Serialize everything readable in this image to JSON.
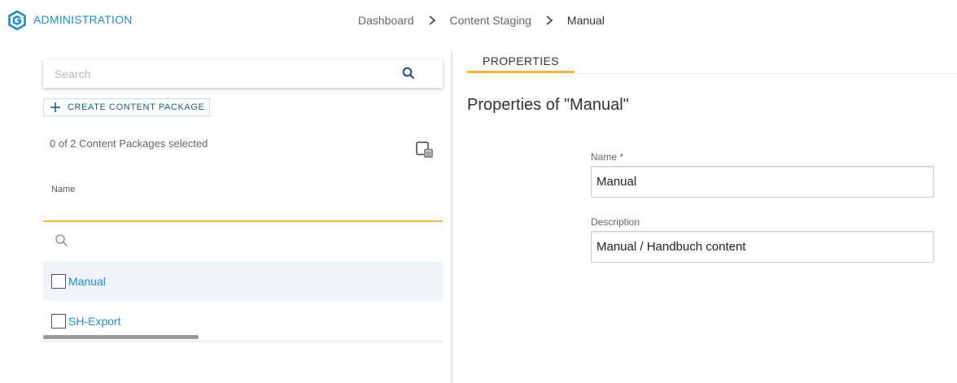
{
  "header": {
    "app_title": "ADMINISTRATION",
    "logo_icon": "brand-logo-icon",
    "accent_color": "#1b8fd3"
  },
  "breadcrumb": {
    "items": [
      "Dashboard",
      "Content Staging",
      "Manual"
    ],
    "separator_icon": "chevron-right-icon"
  },
  "left_panel": {
    "search": {
      "placeholder": "Search",
      "value": "",
      "icon": "search-icon"
    },
    "create_button": {
      "label": "CREATE CONTENT PACKAGE",
      "icon": "plus-icon"
    },
    "selection_status": "0 of 2 Content Packages selected",
    "column_toggle_icon": "column-chooser-icon",
    "table": {
      "columns": [
        "Name"
      ],
      "filter_icon": "search-icon",
      "rows": [
        {
          "name": "Manual",
          "checked": false,
          "highlighted": true
        },
        {
          "name": "SH-Export",
          "checked": false,
          "highlighted": false
        }
      ]
    }
  },
  "right_panel": {
    "tabs": [
      {
        "label": "PROPERTIES",
        "active": true
      }
    ],
    "title": "Properties of \"Manual\"",
    "fields": {
      "name": {
        "label": "Name *",
        "value": "Manual"
      },
      "description": {
        "label": "Description",
        "value": "Manual / Handbuch content"
      }
    }
  },
  "colors": {
    "tab_accent": "#f5b24a",
    "link": "#1b8fd3",
    "row_highlight": "#eef4fa"
  }
}
